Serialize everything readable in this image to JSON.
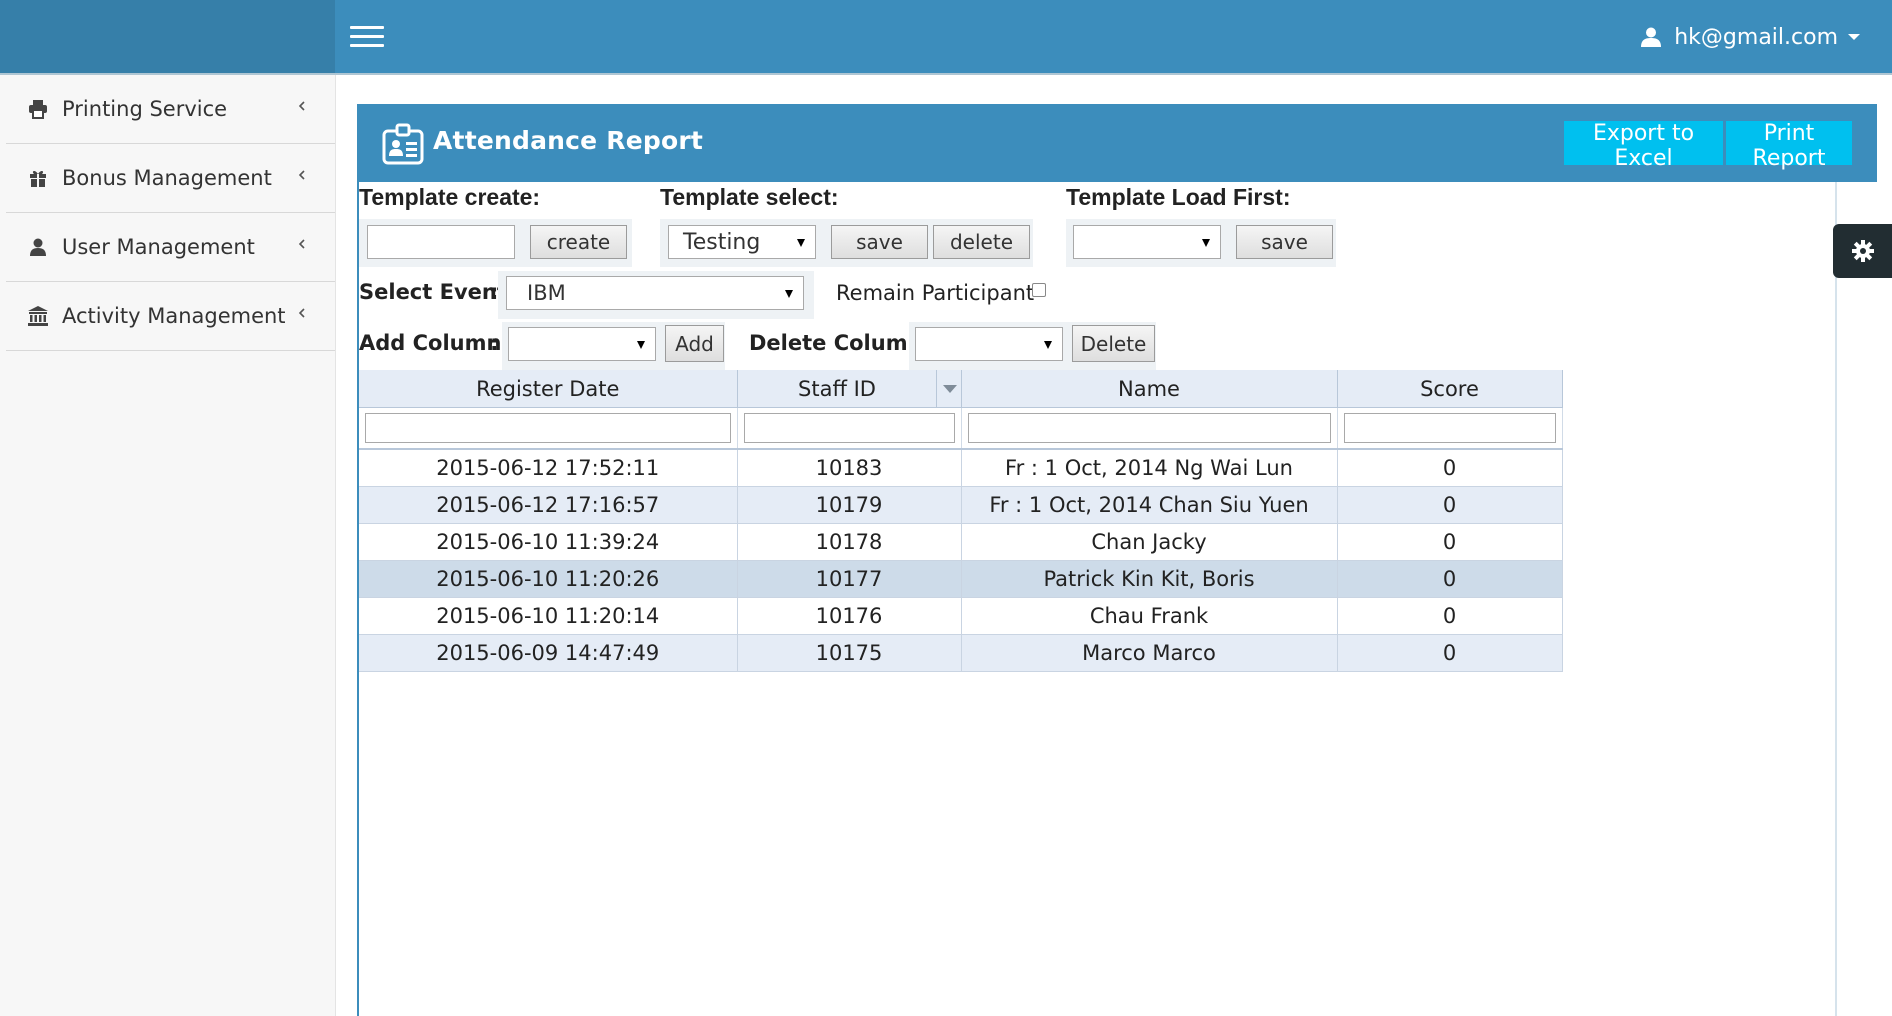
{
  "header": {
    "user_email": "hk@gmail.com"
  },
  "sidebar": {
    "items": [
      {
        "label": "Printing Service",
        "icon": "printer-icon"
      },
      {
        "label": "Bonus Management",
        "icon": "gift-icon"
      },
      {
        "label": "User Management",
        "icon": "user-icon"
      },
      {
        "label": "Activity Management",
        "icon": "bank-icon"
      }
    ]
  },
  "panel": {
    "title": "Attendance Report",
    "export_label": "Export to Excel",
    "print_label": "Print Report"
  },
  "form": {
    "template_create": {
      "label": "Template create:",
      "value": "",
      "button": "create"
    },
    "template_select": {
      "label": "Template select:",
      "selected": "Testing",
      "save": "save",
      "delete": "delete"
    },
    "template_load_first": {
      "label": "Template Load First:",
      "selected": "",
      "save": "save"
    },
    "select_event": {
      "label": "Select Event",
      "colon": ":",
      "selected": "IBM"
    },
    "remain_participant": {
      "label": "Remain Participant",
      "checked": false
    },
    "add_column": {
      "label": "Add Column",
      "colon": ":",
      "selected": "",
      "button": "Add"
    },
    "delete_column": {
      "label": "Delete Column :",
      "selected": "",
      "button": "Delete"
    }
  },
  "table": {
    "columns": [
      "Register Date",
      "Staff ID",
      "Name",
      "Score"
    ],
    "rows": [
      [
        "2015-06-12 17:52:11",
        "10183",
        "Fr : 1 Oct, 2014 Ng Wai Lun",
        "0"
      ],
      [
        "2015-06-12 17:16:57",
        "10179",
        "Fr : 1 Oct, 2014 Chan Siu Yuen",
        "0"
      ],
      [
        "2015-06-10 11:39:24",
        "10178",
        "Chan Jacky",
        "0"
      ],
      [
        "2015-06-10 11:20:26",
        "10177",
        "Patrick Kin Kit, Boris",
        "0"
      ],
      [
        "2015-06-10 11:20:14",
        "10176",
        "Chau Frank",
        "0"
      ],
      [
        "2015-06-09 14:47:49",
        "10175",
        "Marco Marco",
        "0"
      ]
    ]
  },
  "colors": {
    "header_blue": "#3c8dbc",
    "header_dark": "#367fa9",
    "accent_aqua": "#00c0ef"
  }
}
